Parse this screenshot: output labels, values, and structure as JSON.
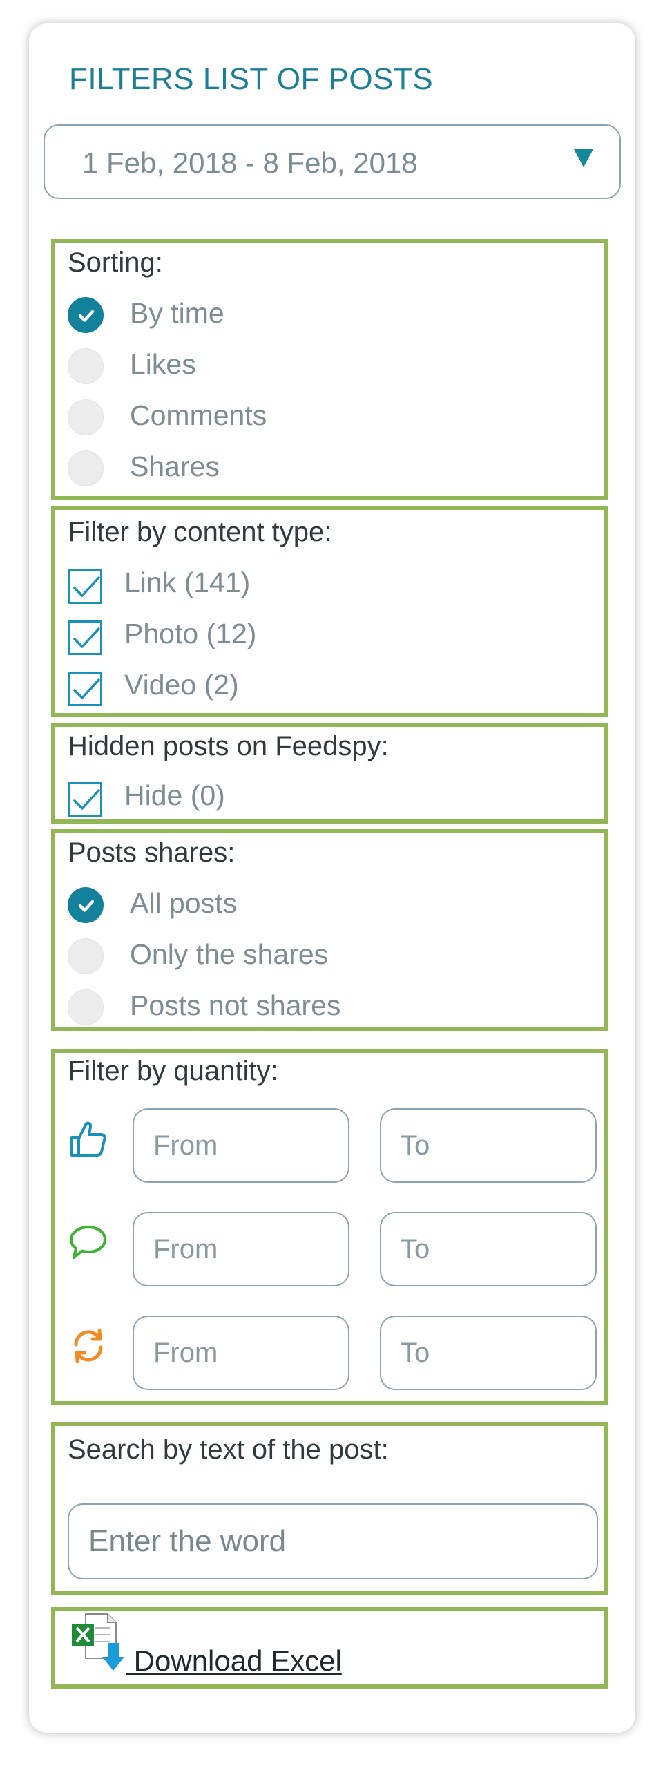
{
  "title": "FILTERS LIST OF POSTS",
  "date_range": "1 Feb, 2018 - 8 Feb, 2018",
  "sorting": {
    "label": "Sorting:",
    "options": [
      {
        "label": "By time",
        "checked": true
      },
      {
        "label": "Likes",
        "checked": false
      },
      {
        "label": "Comments",
        "checked": false
      },
      {
        "label": "Shares",
        "checked": false
      }
    ]
  },
  "content_type": {
    "label": "Filter by content type:",
    "options": [
      {
        "label": "Link (141)",
        "checked": true
      },
      {
        "label": "Photo (12)",
        "checked": true
      },
      {
        "label": "Video (2)",
        "checked": true
      }
    ]
  },
  "hidden_posts": {
    "label": "Hidden posts on Feedspy:",
    "option": {
      "label": "Hide (0)",
      "checked": true
    }
  },
  "post_shares": {
    "label": "Posts shares:",
    "options": [
      {
        "label": "All posts",
        "checked": true
      },
      {
        "label": "Only the shares",
        "checked": false
      },
      {
        "label": "Posts not shares",
        "checked": false
      }
    ]
  },
  "quantity": {
    "label": "Filter by quantity:",
    "rows": [
      {
        "icon": "thumbs-up-icon",
        "from_placeholder": "From",
        "to_placeholder": "To"
      },
      {
        "icon": "comment-bubble-icon",
        "from_placeholder": "From",
        "to_placeholder": "To"
      },
      {
        "icon": "refresh-share-icon",
        "from_placeholder": "From",
        "to_placeholder": "To"
      }
    ]
  },
  "search": {
    "label": "Search by text of the post:",
    "placeholder": "Enter the word"
  },
  "download": {
    "label": " Download Excel",
    "icon": "excel-download-icon"
  },
  "colors": {
    "accent": "#1c7f96",
    "section_border": "#94b755",
    "checkbox": "#1a91b8",
    "like_icon": "#1a91b8",
    "comment_icon": "#3cb431",
    "share_icon": "#f08c23"
  }
}
